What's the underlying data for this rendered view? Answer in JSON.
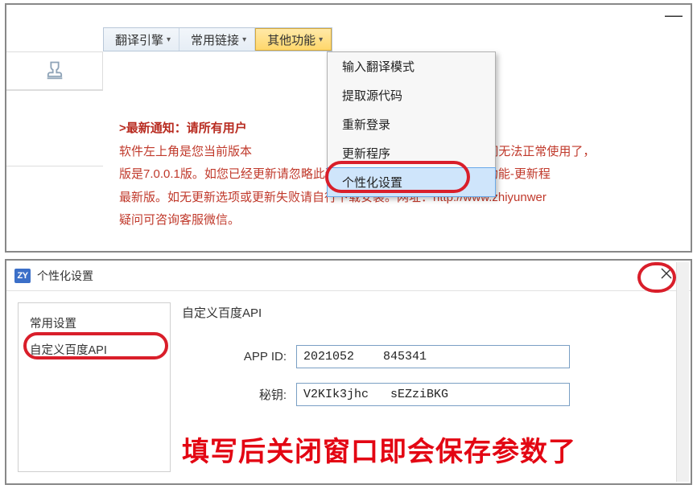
{
  "top": {
    "menu": {
      "engine": "翻译引擎",
      "links": "常用链接",
      "other": "其他功能"
    },
    "dropdown": {
      "items": [
        "输入翻译模式",
        "提取源代码",
        "重新登录",
        "更新程序",
        "个性化设置"
      ]
    },
    "notice_title": ">最新通知：请所有用户",
    "notice_line1_a": "软件左上角是您当前版本",
    "notice_line1_b": "bug已关闭无法正常使用了，",
    "notice_line2": "版是7.0.0.1版。如您已经更新请忽略此通知。旧版本请上方菜单“其他功能-更新程",
    "notice_line3": "最新版。如无更新选项或更新失败请自行下载安装。网址：http://www.zhiyunwer",
    "notice_line4": "疑问可咨询客服微信。"
  },
  "dialog": {
    "icon_text": "ZY",
    "title": "个性化设置",
    "sidebar": {
      "item0": "常用设置",
      "item1": "自定义百度API"
    },
    "form": {
      "section_title": "自定义百度API",
      "appid_label": "APP ID:",
      "appid_value": "2021052    845341",
      "secret_label": "秘钥:",
      "secret_value": "V2KIk3jhc   sEZziBKG"
    },
    "big_note": "填写后关闭窗口即会保存参数了"
  }
}
